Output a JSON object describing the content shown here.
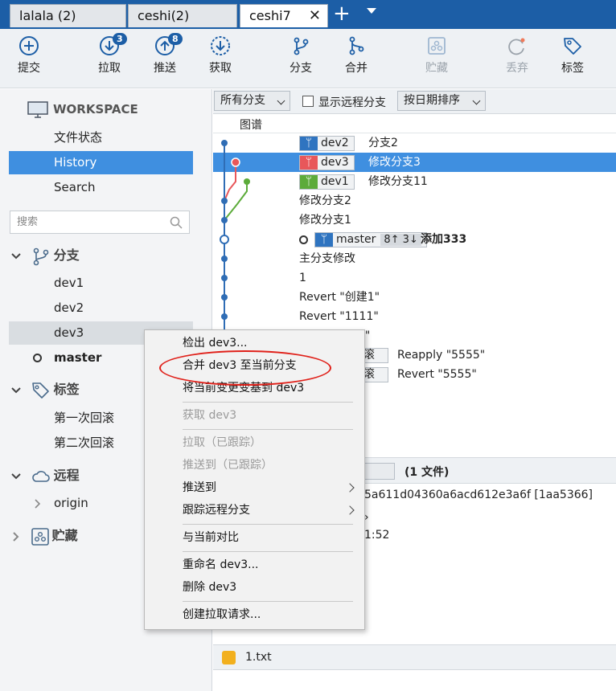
{
  "tabs": [
    {
      "label": "lalala (2)"
    },
    {
      "label": "ceshi(2)"
    },
    {
      "label": "ceshi7",
      "active": true
    }
  ],
  "toolbar": {
    "commit": "提交",
    "pull": "拉取",
    "pull_badge": "3",
    "push": "推送",
    "push_badge": "8",
    "fetch": "获取",
    "branch": "分支",
    "merge": "合并",
    "stash": "贮藏",
    "discard": "丢弃",
    "tag": "标签"
  },
  "sidebar": {
    "workspace_title": "WORKSPACE",
    "workspace_items": [
      "文件状态",
      "History",
      "Search"
    ],
    "search_placeholder": "搜索",
    "branches_title": "分支",
    "branches": [
      "dev1",
      "dev2",
      "dev3",
      "master"
    ],
    "tags_title": "标签",
    "tags": [
      "第一次回滚",
      "第二次回滚"
    ],
    "remotes_title": "远程",
    "remotes": [
      "origin"
    ],
    "stashes_title": "贮藏"
  },
  "filterbar": {
    "all_branches": "所有分支",
    "show_remote": "显示远程分支",
    "sort": "按日期排序"
  },
  "graph_header": "图谱",
  "commits": [
    {
      "branch": "dev2",
      "message": "分支2"
    },
    {
      "branch": "dev3",
      "message": "修改分支3"
    },
    {
      "branch": "dev1",
      "message": "修改分支11"
    },
    {
      "message": "修改分支2"
    },
    {
      "message": "修改分支1"
    },
    {
      "branch": "master",
      "ahead_behind": "8↑ 3↓",
      "message": "添加333"
    },
    {
      "message": "主分支修改"
    },
    {
      "message": "1"
    },
    {
      "message": "Revert \"创建1\""
    },
    {
      "message": "Revert \"1111\""
    },
    {
      "message": "5\""
    },
    {
      "branch_partial": "滚",
      "message": "Reapply \"5555\""
    },
    {
      "branch_partial": "滚",
      "message": "Revert \"5555\""
    }
  ],
  "details": {
    "files_count": "(1 文件)",
    "hash_partial": "5a611d04360a6acd612e3a6f [1aa5366]",
    "arrow_partial": "›",
    "time_partial": "1:52",
    "file_name": "1.txt"
  },
  "context_menu": {
    "items": [
      {
        "label": "检出 dev3...",
        "disabled": false
      },
      {
        "label": "合并 dev3 至当前分支",
        "disabled": false
      },
      {
        "label": "将当前变更变基到 dev3",
        "disabled": false
      },
      {
        "label": "获取 dev3",
        "disabled": true
      },
      {
        "label": "拉取（已跟踪）",
        "disabled": true
      },
      {
        "label": "推送到（已跟踪）",
        "disabled": true
      },
      {
        "label": "推送到",
        "disabled": false,
        "submenu": true
      },
      {
        "label": "跟踪远程分支",
        "disabled": false,
        "submenu": true
      },
      {
        "label": "与当前对比",
        "disabled": false
      },
      {
        "label": "重命名 dev3...",
        "disabled": false
      },
      {
        "label": "删除 dev3",
        "disabled": false
      },
      {
        "label": "创建拉取请求...",
        "disabled": false
      }
    ]
  },
  "colors": {
    "accent": "#1c5ea6",
    "selection": "#3f8fe0",
    "dev3_branch": "#e8575a",
    "dev1_branch": "#5cab3a",
    "annotation": "#e0211a"
  }
}
